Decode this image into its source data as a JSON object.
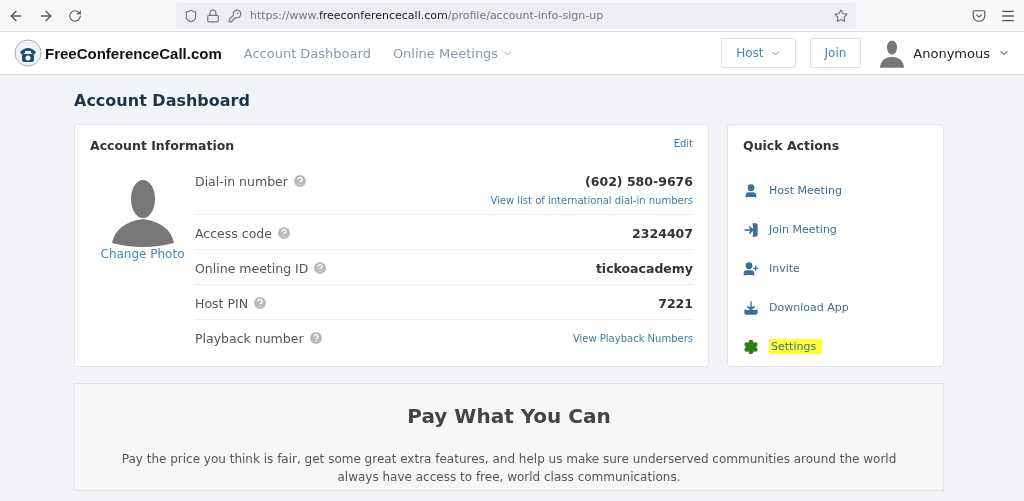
{
  "browser": {
    "url_host": "https://www.",
    "url_domain": "freeconferencecall.com",
    "url_path": "/profile/account-info-sign-up"
  },
  "nav": {
    "logo": "FreeConferenceCall.com",
    "links": [
      {
        "label": "Account Dashboard",
        "dropdown": false
      },
      {
        "label": "Online Meetings",
        "dropdown": true
      }
    ],
    "host_button": "Host",
    "join_button": "Join",
    "user": "Anonymous"
  },
  "page_title": "Account Dashboard",
  "account": {
    "title": "Account Information",
    "edit": "Edit",
    "change_photo": "Change Photo",
    "rows": [
      {
        "label": "Dial-in number",
        "value": "(602) 580-9676",
        "link": "View list of international dial-in numbers"
      },
      {
        "label": "Access code",
        "value": "2324407"
      },
      {
        "label": "Online meeting ID",
        "value": "tickoacademy"
      },
      {
        "label": "Host PIN",
        "value": "7221"
      },
      {
        "label": "Playback number",
        "link": "View Playback Numbers"
      }
    ]
  },
  "quick_actions": {
    "title": "Quick Actions",
    "items": [
      {
        "kind": "host",
        "label": "Host Meeting",
        "highlighted": false
      },
      {
        "kind": "join",
        "label": "Join Meeting",
        "highlighted": false
      },
      {
        "kind": "invite",
        "label": "Invite",
        "highlighted": false
      },
      {
        "kind": "download",
        "label": "Download App",
        "highlighted": false
      },
      {
        "kind": "settings",
        "label": "Settings",
        "highlighted": true
      }
    ]
  },
  "pay": {
    "title": "Pay What You Can",
    "text": "Pay the price you think is fair, get some great extra features, and help us make sure underserved communities around the world always have access to free, world class communications."
  }
}
